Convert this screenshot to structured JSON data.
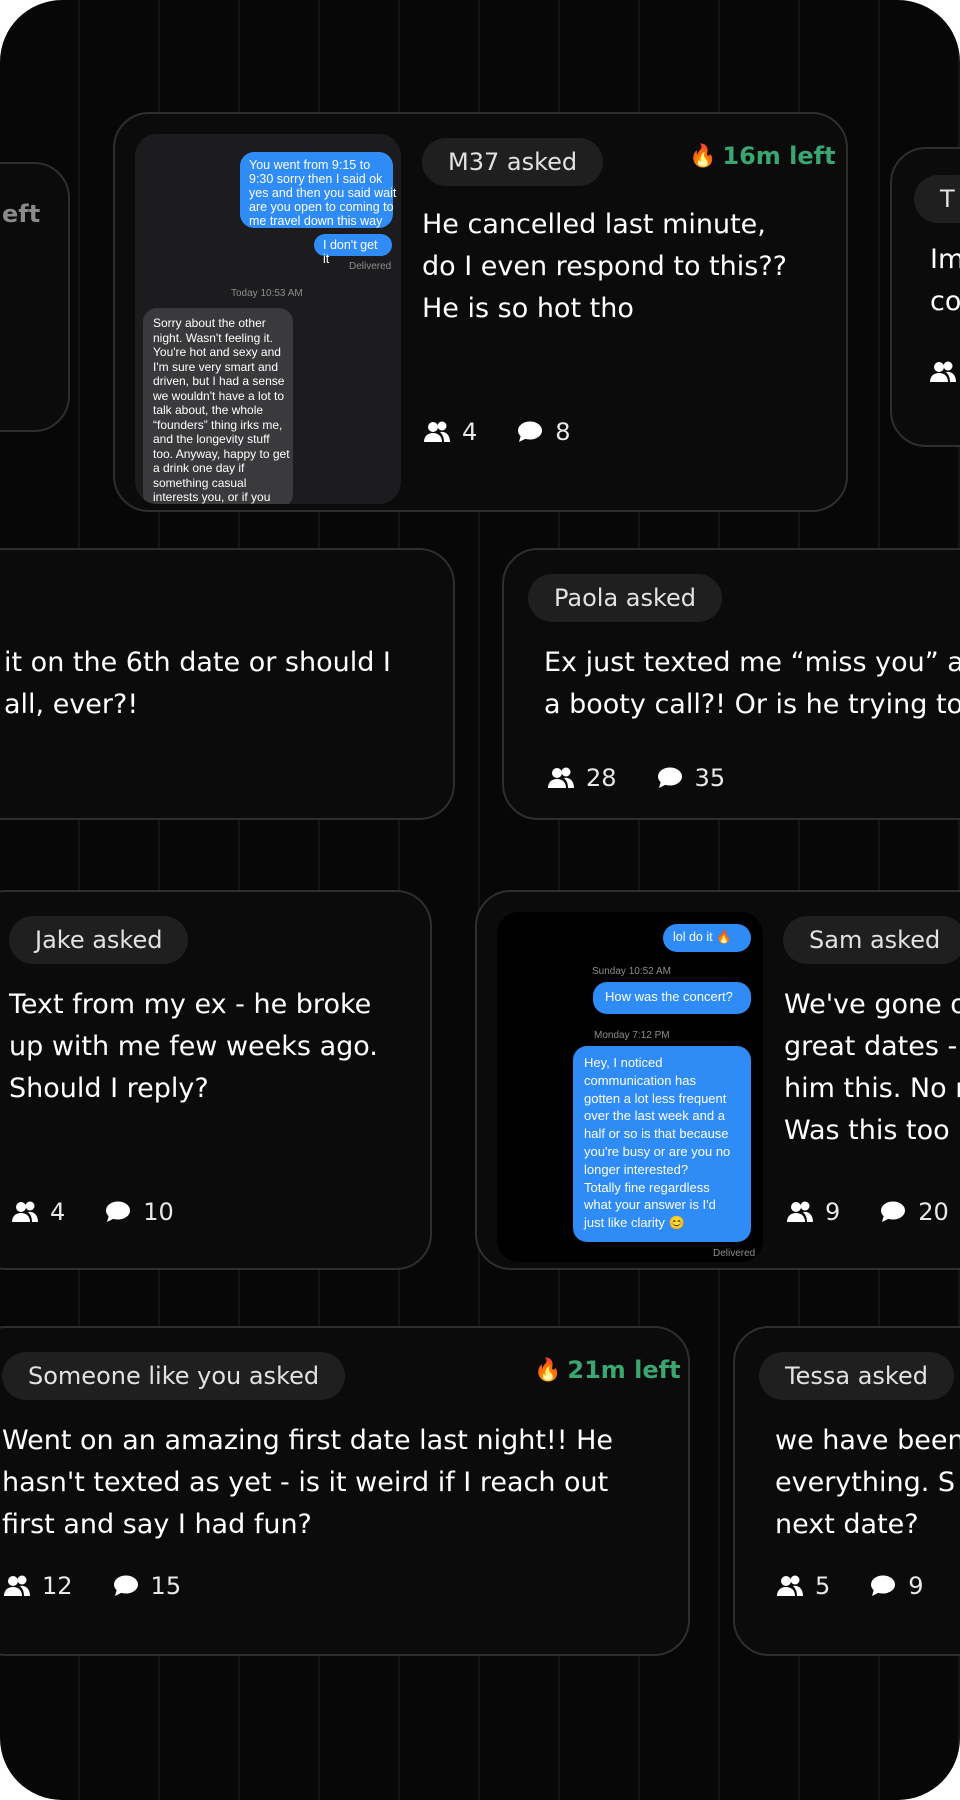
{
  "cards": {
    "c1": {
      "label": "M37 asked",
      "timer": "16m left",
      "lines": [
        "He cancelled last minute,",
        "do I even respond to this??",
        "He is so hot tho"
      ],
      "participants": "4",
      "comments": "8",
      "shot": {
        "sent": [
          "You went from 9:15 to",
          "9:30 sorry then I said ok",
          "yes and then you said wait",
          "are you open to coming to",
          "me travel down this way"
        ],
        "reply": "I don't get it",
        "delivered": "Delivered",
        "timestamp": "Today 10:53 AM",
        "received": [
          "Sorry about the other",
          "night. Wasn't feeling it.",
          "You're hot and sexy and",
          "I'm sure very smart and",
          "driven, but I had a sense",
          "we wouldn't have a lot to",
          "talk about, the whole",
          "“founders” thing irks me,",
          "and the longevity stuff",
          "too. Anyway, happy to get",
          "a drink one day if",
          "something casual",
          "interests you, or if you"
        ]
      }
    },
    "c_left_top": {
      "timer_partial": "eft"
    },
    "c_right_top": {
      "label_partial": "T",
      "lines": [
        "Im",
        "co"
      ]
    },
    "c2": {
      "lines": [
        "it on the 6th date or should I",
        "all, ever?!"
      ]
    },
    "c3": {
      "label": "Paola asked",
      "lines": [
        "Ex just texted me “miss you” a",
        "a booty call?! Or is he trying to"
      ],
      "participants": "28",
      "comments": "35"
    },
    "c4": {
      "label": "Jake asked",
      "lines": [
        "Text from my ex - he broke",
        "up with me few weeks ago.",
        "Should I reply?"
      ],
      "participants": "4",
      "comments": "10"
    },
    "c5": {
      "label": "Sam asked",
      "lines": [
        "We've gone o",
        "great dates -",
        "him this. No m",
        "Was this too"
      ],
      "participants": "9",
      "comments": "20",
      "shot": {
        "top_reply": "lol do it 🔥",
        "ts1": "Sunday 10:52 AM",
        "q": "How was the concert?",
        "ts2": "Monday 7:12 PM",
        "long": [
          "Hey, I noticed",
          "communication has",
          "gotten a lot less frequent",
          "over the last week and a",
          "half or so is that because",
          "you're busy or are you no",
          "longer interested?",
          "Totally fine regardless",
          "what your answer is I'd",
          "just like clarity 😊"
        ],
        "delivered": "Delivered"
      }
    },
    "c6": {
      "label": "Someone like you asked",
      "timer": "21m left",
      "lines": [
        "Went on an amazing first date last night!! He",
        "hasn't texted as yet - is it weird if I reach out",
        "first and say I had fun?"
      ],
      "participants": "12",
      "comments": "15"
    },
    "c7": {
      "label": "Tessa asked",
      "lines": [
        "we have been",
        "everything. S",
        "next date?"
      ],
      "participants": "5",
      "comments": "9"
    }
  },
  "colors": {
    "background": "#070707",
    "card": "#0b0b0b",
    "chip": "#1f1f1f",
    "timer": "#3aa672",
    "imessage_blue": "#2f8cf6"
  },
  "icons": {
    "participants": "people-icon",
    "comments": "chat-bubble-icon",
    "timer": "fire-icon"
  }
}
